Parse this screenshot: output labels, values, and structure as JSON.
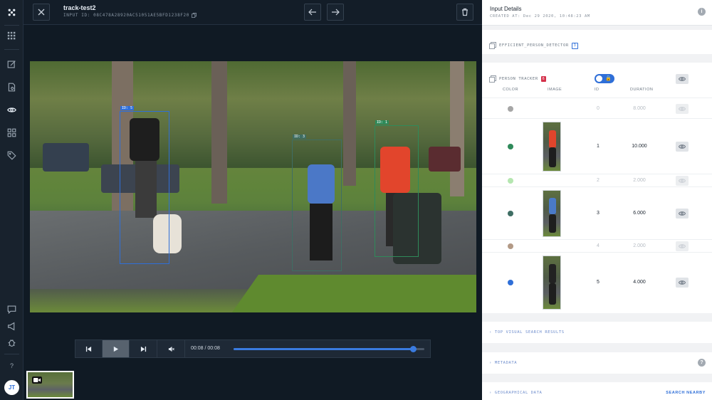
{
  "header": {
    "title": "track-test2",
    "input_id": "INPUT ID: 08C478A28920AC51051AE5BFD1238F20"
  },
  "rail": {
    "avatar_initials": "JT",
    "help_label": "?"
  },
  "player": {
    "time": "00:08 / 00:08",
    "progress": 0.94
  },
  "video_labels": {
    "box1": "ID: 5",
    "box2": "ID: 3",
    "box3": "ID: 1"
  },
  "panel": {
    "title": "Input Details",
    "created": "CREATED AT: Dec 29 2020, 10:48:23 AM",
    "info": "i",
    "model1": {
      "name": "EFFICIENT_PERSON_DETECTOR",
      "badge": "3"
    },
    "model2": {
      "name": "PERSON TRACKER",
      "badge": "6"
    },
    "table_headers": {
      "color": "COLOR",
      "image": "IMAGE",
      "id": "ID",
      "duration": "DURATION"
    },
    "rows": [
      {
        "color": "#a6a6a6",
        "id": "0",
        "duration": "8.000",
        "dim": true,
        "image": false
      },
      {
        "color": "#2f8a5a",
        "id": "1",
        "duration": "10.000",
        "dim": false,
        "image": true,
        "shirt": "#e0452c"
      },
      {
        "color": "#b5e6b0",
        "id": "2",
        "duration": "2.000",
        "dim": true,
        "image": false
      },
      {
        "color": "#3f6e64",
        "id": "3",
        "duration": "6.000",
        "dim": false,
        "image": true,
        "shirt": "#4a7ac8"
      },
      {
        "color": "#b39a86",
        "id": "4",
        "duration": "2.000",
        "dim": true,
        "image": false
      },
      {
        "color": "#2f6fd8",
        "id": "5",
        "duration": "4.000",
        "dim": false,
        "image": true,
        "shirt": "#222222"
      }
    ],
    "sections": {
      "visual_search": "TOP VISUAL SEARCH RESULTS",
      "metadata": "METADATA",
      "geo": "GEOGRAPHICAL DATA",
      "search_nearby": "SEARCH NEARBY",
      "help": "?"
    }
  },
  "colors": {
    "accent": "#2f6fd8",
    "badge_red": "#d4314b"
  }
}
